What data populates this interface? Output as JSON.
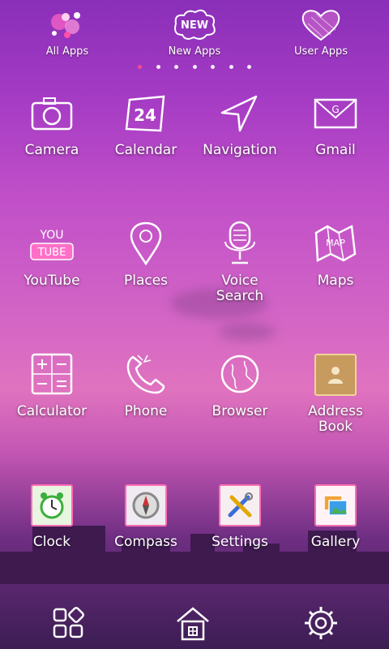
{
  "top_row": {
    "all_apps": "All Apps",
    "new_apps": "New Apps",
    "new_badge": "NEW",
    "user_apps": "User Apps"
  },
  "page_indicator": {
    "count": 7,
    "active": 0
  },
  "apps": [
    {
      "label": "Camera",
      "icon": "camera-icon"
    },
    {
      "label": "Calendar",
      "icon": "calendar-icon",
      "badge": "24"
    },
    {
      "label": "Navigation",
      "icon": "navigation-icon"
    },
    {
      "label": "Gmail",
      "icon": "gmail-icon",
      "badge": "G"
    },
    {
      "label": "YouTube",
      "icon": "youtube-icon",
      "badge_top": "YOU",
      "badge_bottom": "TUBE"
    },
    {
      "label": "Places",
      "icon": "places-icon"
    },
    {
      "label": "Voice\nSearch",
      "icon": "microphone-icon"
    },
    {
      "label": "Maps",
      "icon": "maps-icon",
      "badge": "MAP"
    },
    {
      "label": "Calculator",
      "icon": "calculator-icon"
    },
    {
      "label": "Phone",
      "icon": "phone-icon"
    },
    {
      "label": "Browser",
      "icon": "globe-icon"
    },
    {
      "label": "Address\nBook",
      "icon": "address-book-icon"
    },
    {
      "label": "Clock",
      "icon": "clock-icon"
    },
    {
      "label": "Compass",
      "icon": "compass-icon"
    },
    {
      "label": "Settings",
      "icon": "settings-tools-icon"
    },
    {
      "label": "Gallery",
      "icon": "gallery-icon"
    }
  ],
  "dock": [
    "apps-drawer-icon",
    "home-icon",
    "gear-icon"
  ]
}
